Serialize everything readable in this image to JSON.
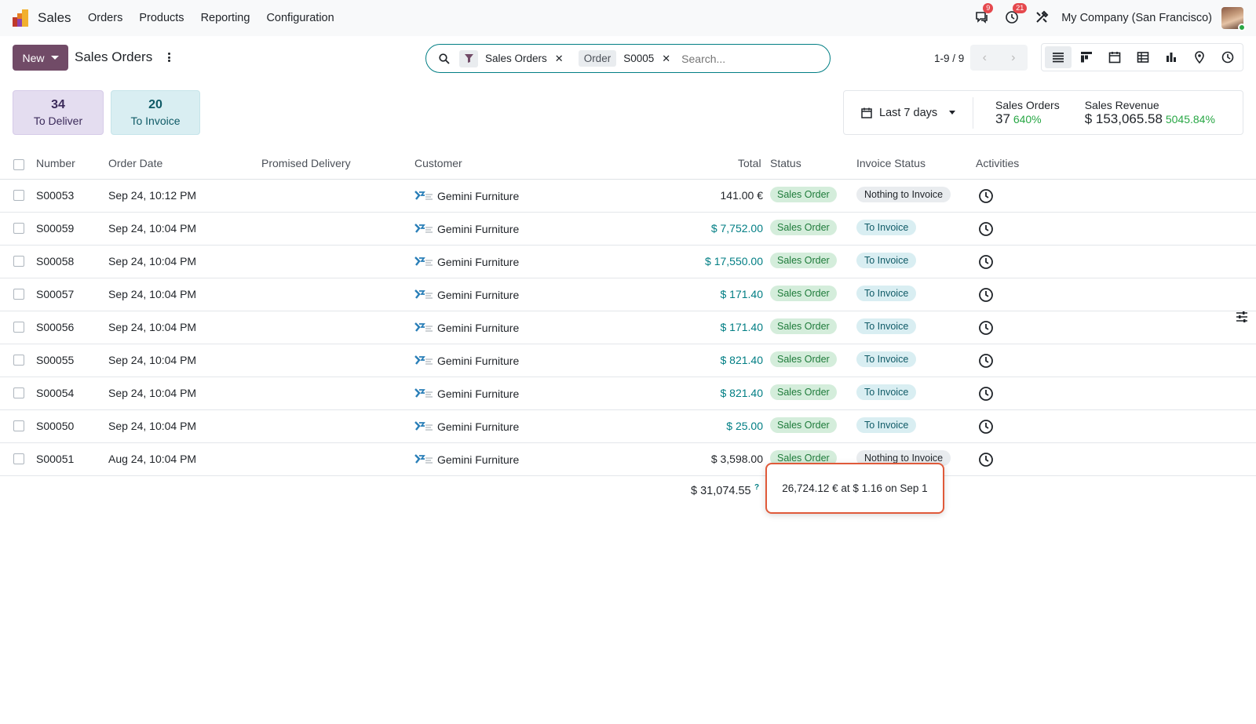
{
  "navbar": {
    "app_name": "Sales",
    "menu": [
      "Orders",
      "Products",
      "Reporting",
      "Configuration"
    ],
    "messages_badge": "9",
    "activities_badge": "21",
    "company": "My Company (San Francisco)"
  },
  "control": {
    "new_label": "New",
    "breadcrumb": "Sales Orders",
    "facets": [
      {
        "type": "filter",
        "text": "Sales Orders"
      },
      {
        "type": "field",
        "label": "Order",
        "text": "S0005"
      }
    ],
    "search_placeholder": "Search...",
    "pager": "1-9 / 9",
    "views": [
      "list-view-icon",
      "kanban-view-icon",
      "calendar-view-icon",
      "pivot-view-icon",
      "graph-view-icon",
      "map-view-icon",
      "activity-view-icon"
    ]
  },
  "tiles": {
    "deliver": {
      "num": "34",
      "label": "To Deliver"
    },
    "invoice": {
      "num": "20",
      "label": "To Invoice"
    }
  },
  "kpis": {
    "period": "Last 7 days",
    "orders": {
      "title": "Sales Orders",
      "value": "37",
      "pct": "640%"
    },
    "revenue": {
      "title": "Sales Revenue",
      "value": "$ 153,065.58",
      "pct": "5045.84%"
    }
  },
  "table": {
    "headers": {
      "number": "Number",
      "order_date": "Order Date",
      "promised": "Promised Delivery",
      "customer": "Customer",
      "total": "Total",
      "status": "Status",
      "invoice_status": "Invoice Status",
      "activities": "Activities"
    },
    "rows": [
      {
        "number": "S00053",
        "date": "Sep 24, 10:12 PM",
        "customer": "Gemini Furniture",
        "total": "141.00 €",
        "status": "Sales Order",
        "invoice": "Nothing to Invoice"
      },
      {
        "number": "S00059",
        "date": "Sep 24, 10:04 PM",
        "customer": "Gemini Furniture",
        "total": "$ 7,752.00",
        "status": "Sales Order",
        "invoice": "To Invoice"
      },
      {
        "number": "S00058",
        "date": "Sep 24, 10:04 PM",
        "customer": "Gemini Furniture",
        "total": "$ 17,550.00",
        "status": "Sales Order",
        "invoice": "To Invoice"
      },
      {
        "number": "S00057",
        "date": "Sep 24, 10:04 PM",
        "customer": "Gemini Furniture",
        "total": "$ 171.40",
        "status": "Sales Order",
        "invoice": "To Invoice"
      },
      {
        "number": "S00056",
        "date": "Sep 24, 10:04 PM",
        "customer": "Gemini Furniture",
        "total": "$ 171.40",
        "status": "Sales Order",
        "invoice": "To Invoice"
      },
      {
        "number": "S00055",
        "date": "Sep 24, 10:04 PM",
        "customer": "Gemini Furniture",
        "total": "$ 821.40",
        "status": "Sales Order",
        "invoice": "To Invoice"
      },
      {
        "number": "S00054",
        "date": "Sep 24, 10:04 PM",
        "customer": "Gemini Furniture",
        "total": "$ 821.40",
        "status": "Sales Order",
        "invoice": "To Invoice"
      },
      {
        "number": "S00050",
        "date": "Sep 24, 10:04 PM",
        "customer": "Gemini Furniture",
        "total": "$ 25.00",
        "status": "Sales Order",
        "invoice": "To Invoice"
      },
      {
        "number": "S00051",
        "date": "Aug 24, 10:04 PM",
        "customer": "Gemini Furniture",
        "total": "$ 3,598.00",
        "status": "Sales Order",
        "invoice": "Nothing to Invoice"
      }
    ],
    "grand_total": "$ 31,074.55",
    "grand_total_hint": "?"
  },
  "tooltip": "26,724.12 € at $ 1.16 on Sep 1",
  "colors": {
    "brand": "#714b67",
    "accent": "#017e84",
    "tooltip_border": "#e05a3a"
  }
}
